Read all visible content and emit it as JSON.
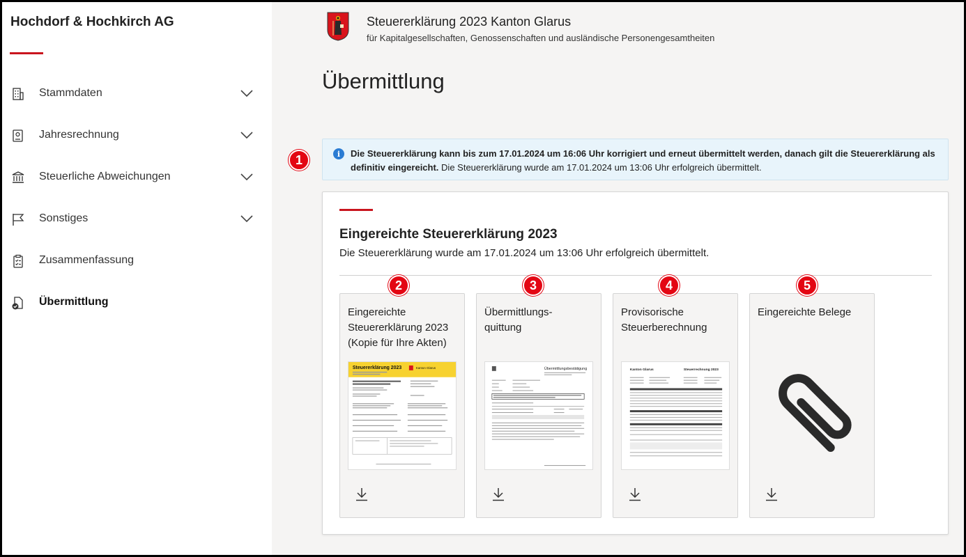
{
  "sidebar": {
    "company": "Hochdorf & Hochkirch AG",
    "items": [
      {
        "label": "Stammdaten",
        "icon": "building-icon"
      },
      {
        "label": "Jahresrechnung",
        "icon": "ledger-icon"
      },
      {
        "label": "Steuerliche Abweichungen",
        "icon": "bank-icon"
      },
      {
        "label": "Sonstiges",
        "icon": "flag-icon"
      },
      {
        "label": "Zusammenfassung",
        "icon": "clipboard-check-icon"
      },
      {
        "label": "Übermittlung",
        "icon": "document-check-icon"
      }
    ]
  },
  "header": {
    "title": "Steuererklärung 2023 Kanton Glarus",
    "subtitle": "für Kapitalgesellschaften, Genossenschaften und ausländische Personengesamtheiten"
  },
  "page_title": "Übermittlung",
  "info": {
    "bold": "Die Steuererklärung kann bis zum 17.01.2024 um 16:06 Uhr korrigiert und erneut übermittelt werden, danach gilt die Steuererklärung als definitiv eingereicht.",
    "normal": "Die Steuererklärung wurde am 17.01.2024 um 13:06 Uhr erfolgreich übermittelt."
  },
  "card": {
    "title": "Eingereichte Steuererklärung 2023",
    "subtitle": "Die Steuererklärung wurde am 17.01.2024 um 13:06 Uhr erfolgreich übermittelt."
  },
  "tiles": [
    {
      "label": "Eingereichte Steuererklärung 2023 (Kopie für Ihre Akten)"
    },
    {
      "label": "Übermittlungs-quittung"
    },
    {
      "label": "Provisorische Steuerberechnung"
    },
    {
      "label": "Eingereichte Belege"
    }
  ],
  "markers": [
    "1",
    "2",
    "3",
    "4",
    "5"
  ],
  "thumb_text": {
    "doc1_title": "Steuererklärung 2023",
    "doc1_canton": "Kanton Glarus",
    "doc2_title": "Übermittlungsbestätigung",
    "doc3_canton": "Kanton Glarus",
    "doc3_title": "Steuerrechnung 2023"
  },
  "colors": {
    "accent": "#c9151e",
    "marker": "#e30613",
    "info_bg": "#e8f4fb",
    "info_icon": "#2b7cd3"
  }
}
